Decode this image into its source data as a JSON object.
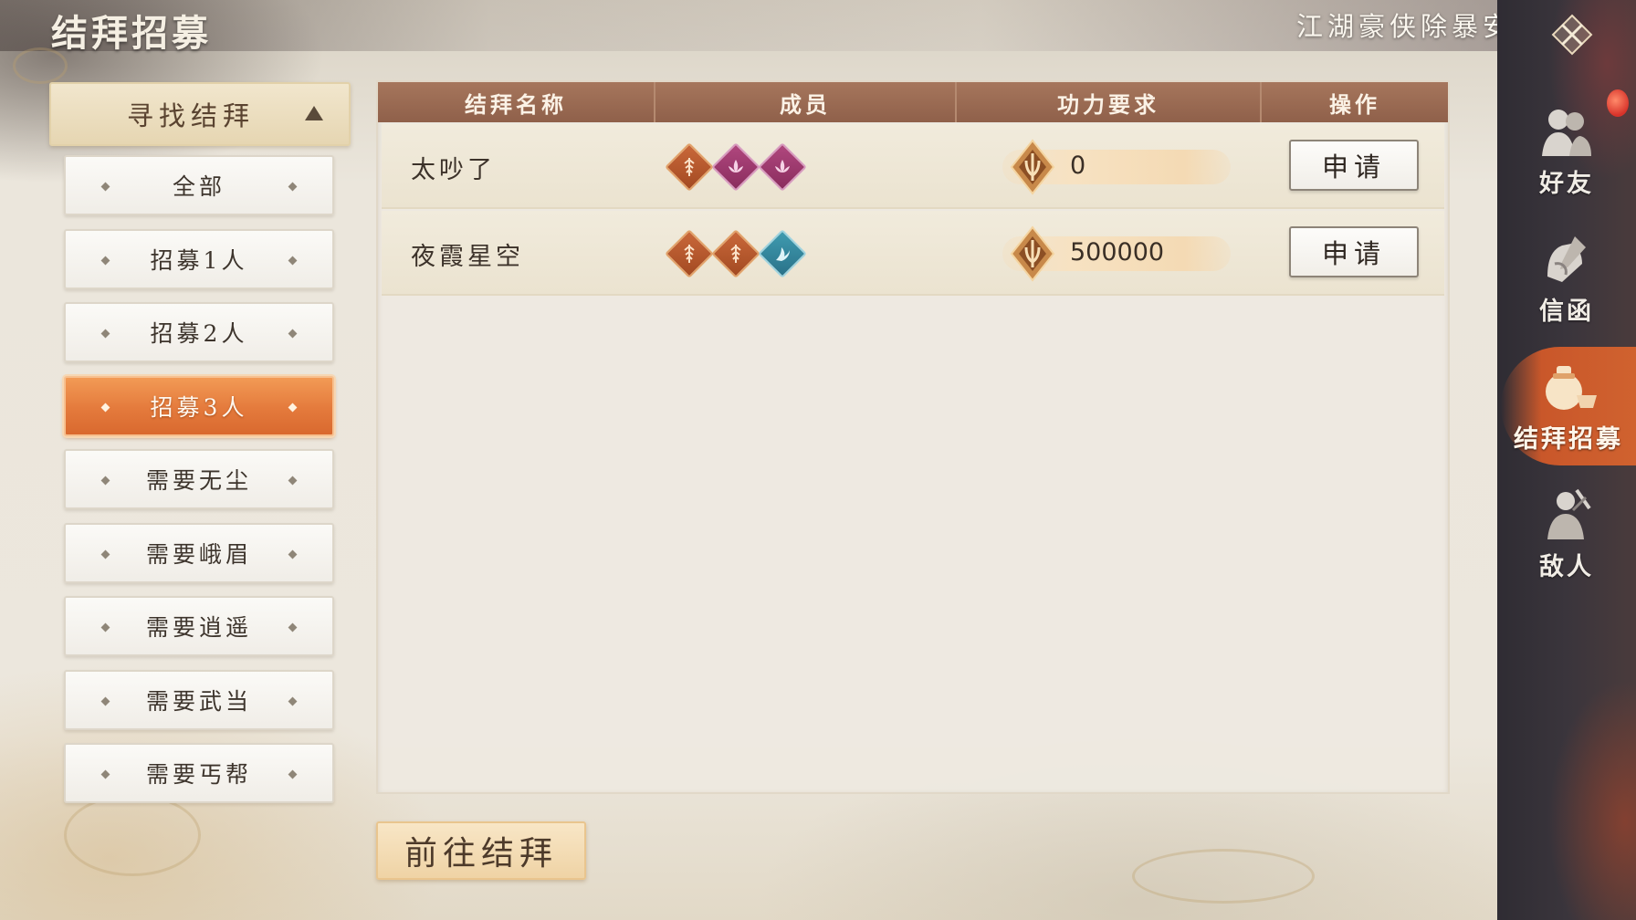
{
  "header": {
    "title": "结拜招募",
    "slogan": "江湖豪侠除暴安良"
  },
  "filter": {
    "header_label": "寻找结拜",
    "items": [
      {
        "label": "全部",
        "active": false
      },
      {
        "label": "招募1人",
        "active": false
      },
      {
        "label": "招募2人",
        "active": false
      },
      {
        "label": "招募3人",
        "active": true
      },
      {
        "label": "需要无尘",
        "active": false
      },
      {
        "label": "需要峨眉",
        "active": false
      },
      {
        "label": "需要逍遥",
        "active": false
      },
      {
        "label": "需要武当",
        "active": false
      },
      {
        "label": "需要丐帮",
        "active": false
      }
    ]
  },
  "table": {
    "columns": [
      "结拜名称",
      "成员",
      "功力要求",
      "操作"
    ],
    "rows": [
      {
        "name": "太吵了",
        "members": [
          "orange-sect-icon",
          "purple-lotus-icon",
          "purple-lotus-icon"
        ],
        "power": "0",
        "action": "申请"
      },
      {
        "name": "夜霞星空",
        "members": [
          "orange-sect-icon",
          "orange-sect-icon",
          "teal-crane-icon"
        ],
        "power": "500000",
        "action": "申请"
      }
    ]
  },
  "go_button": "前往结拜",
  "side_nav": [
    {
      "label": "好友",
      "icon": "friends-icon",
      "active": false
    },
    {
      "label": "信函",
      "icon": "letter-icon",
      "active": false
    },
    {
      "label": "结拜招募",
      "icon": "wine-jar-icon",
      "active": true
    },
    {
      "label": "敌人",
      "icon": "enemy-icon",
      "active": false
    }
  ],
  "colors": {
    "header_bar": "#8f604a",
    "active_filter": "#e47a3c",
    "member_orange": "#a34a22",
    "member_purple": "#8a2d5e",
    "member_teal": "#2a7289"
  }
}
